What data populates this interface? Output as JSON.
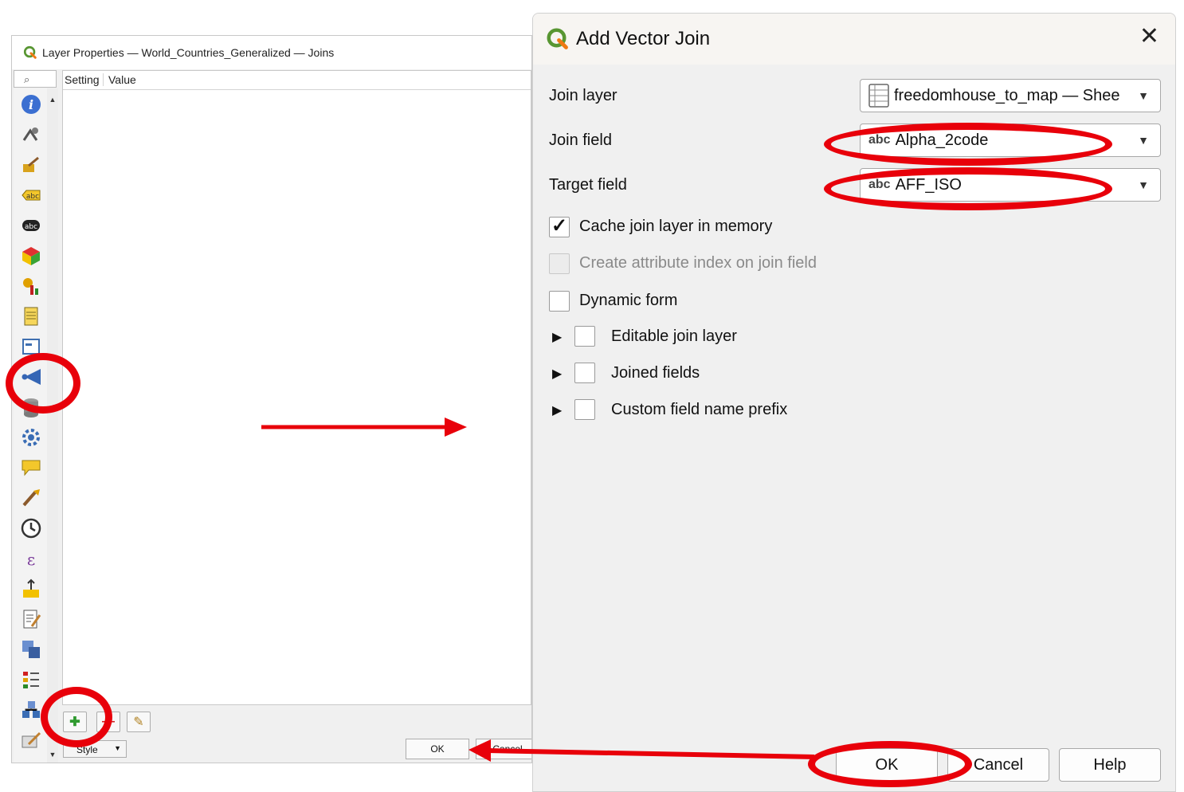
{
  "layer_properties": {
    "title": "Layer Properties — World_Countries_Generalized — Joins",
    "search_icon": "⌕",
    "columns": {
      "setting": "Setting",
      "value": "Value"
    },
    "sidebar_icons": [
      "info-icon",
      "source-icon",
      "symbology-icon",
      "labels-icon",
      "masks-icon",
      "3d-view-icon",
      "diagrams-icon",
      "fields-icon",
      "attributes-form-icon",
      "joins-icon",
      "auxiliary-storage-icon",
      "actions-icon",
      "display-icon",
      "rendering-icon",
      "temporal-icon",
      "variables-icon",
      "elevation-icon",
      "metadata-icon",
      "dependencies-icon",
      "legend-icon",
      "server-icon",
      "digitizing-icon"
    ],
    "tools": {
      "add": "✚",
      "remove": "—",
      "edit": "✎"
    },
    "style_label": "Style",
    "ok_label": "OK",
    "cancel_label": "Cancel"
  },
  "add_vector_join": {
    "title": "Add Vector Join",
    "close_glyph": "✕",
    "join_layer": {
      "label": "Join layer",
      "value": "freedomhouse_to_map — Shee"
    },
    "join_field": {
      "label": "Join field",
      "type_prefix": "abc",
      "value": "Alpha_2code"
    },
    "target_field": {
      "label": "Target field",
      "type_prefix": "abc",
      "value": "AFF_ISO"
    },
    "options": {
      "cache": {
        "label": "Cache join layer in memory",
        "checked": true
      },
      "attr_index": {
        "label": "Create attribute index on join field",
        "checked": false,
        "enabled": false
      },
      "dynamic_form": {
        "label": "Dynamic form",
        "checked": false
      }
    },
    "groups": {
      "editable": {
        "label": "Editable join layer",
        "checked": false
      },
      "joined_fields": {
        "label": "Joined fields",
        "checked": false
      },
      "prefix": {
        "label": "Custom field name prefix",
        "checked": false
      }
    },
    "buttons": {
      "ok": "OK",
      "cancel": "Cancel",
      "help": "Help"
    }
  },
  "annotation_color": "#e8000a"
}
